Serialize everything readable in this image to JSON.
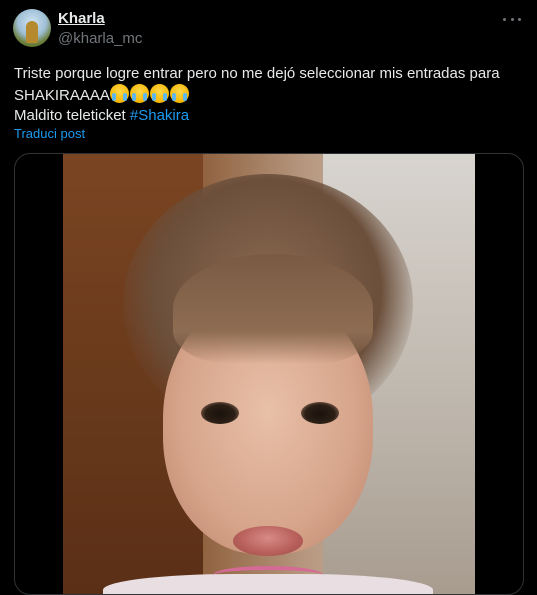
{
  "tweet": {
    "author_name": "Kharla",
    "author_handle": "@kharla_mc",
    "text_line1": "Triste porque logre entrar pero no me dejó seleccionar mis entradas para",
    "text_line2": "SHAKIRAAAA",
    "text_line2_emojis": [
      "loudly-crying-face",
      "loudly-crying-face",
      "loudly-crying-face",
      "loudly-crying-face"
    ],
    "text_line3_prefix": "Maldito teleticket",
    "hashtag": "#Shakira",
    "translate_label": "Traduci post"
  },
  "colors": {
    "background": "#000000",
    "text": "#e7e9ea",
    "muted": "#71767b",
    "link": "#1d9bf0",
    "border": "#2f3336"
  },
  "icons": {
    "more": "more-horizontal-icon"
  }
}
